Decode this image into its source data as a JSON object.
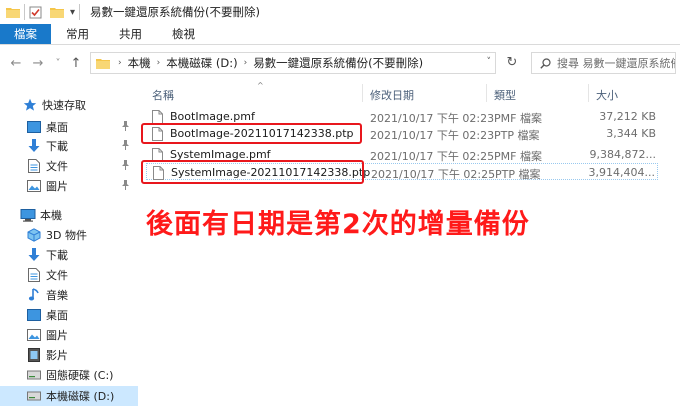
{
  "window": {
    "title": "易數一鍵還原系統備份(不要刪除)",
    "qat_dropdown": "▾"
  },
  "ribbon": {
    "tabs": [
      {
        "label": "檔案",
        "active": true
      },
      {
        "label": "常用"
      },
      {
        "label": "共用"
      },
      {
        "label": "檢視"
      }
    ]
  },
  "nav": {
    "back": "←",
    "forward": "→",
    "recent": "˅",
    "up": "↑",
    "refresh": "↻"
  },
  "address": {
    "crumbs": [
      "本機",
      "本機磁碟 (D:)",
      "易數一鍵還原系統備份(不要刪除)"
    ],
    "separator": "›",
    "dropdown": "˅"
  },
  "search": {
    "placeholder": "搜尋 易數一鍵還原系統備..."
  },
  "sidebar": {
    "quick_access": "快速存取",
    "quick_items": [
      "桌面",
      "下載",
      "文件",
      "圖片"
    ],
    "pin": "📌",
    "this_pc": "本機",
    "pc_items": [
      "3D 物件",
      "下載",
      "文件",
      "音樂",
      "桌面",
      "圖片",
      "影片",
      "固態硬碟 (C:)",
      "本機磁碟 (D:)"
    ]
  },
  "columns": {
    "name": "名稱",
    "modified": "修改日期",
    "type": "類型",
    "size": "大小",
    "sort_indicator": "^"
  },
  "files": [
    {
      "name": "BootImage.pmf",
      "modified": "2021/10/17 下午 02:23",
      "type": "PMF 檔案",
      "size": "37,212 KB"
    },
    {
      "name": "BootImage-20211017142338.ptp",
      "modified": "2021/10/17 下午 02:23",
      "type": "PTP 檔案",
      "size": "3,344 KB"
    },
    {
      "name": "SystemImage.pmf",
      "modified": "2021/10/17 下午 02:25",
      "type": "PMF 檔案",
      "size": "9,384,872..."
    },
    {
      "name": "SystemImage-20211017142338.ptp",
      "modified": "2021/10/17 下午 02:25",
      "type": "PTP 檔案",
      "size": "3,914,404..."
    }
  ],
  "annotation": {
    "text": "後面有日期是第2次的增量備份"
  },
  "colors": {
    "accent": "#1979ca",
    "selection": "#cce8ff",
    "annotation_red": "#ff1a1a",
    "folder_yellow": "#f5c64a"
  }
}
